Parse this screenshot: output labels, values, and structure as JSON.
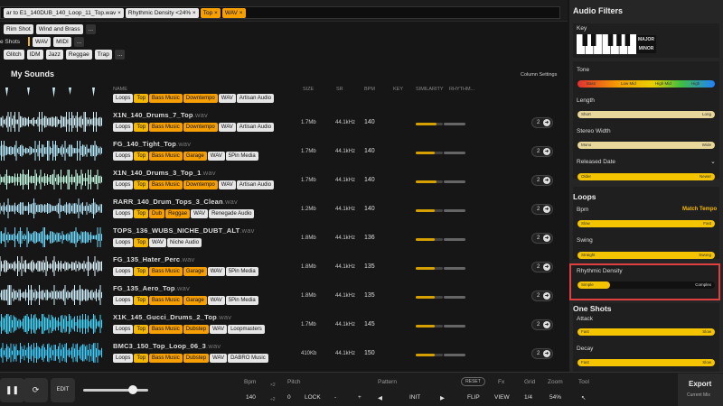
{
  "filter_bar": {
    "chips": [
      {
        "label": "ar to E1_140DUB_140_Loop_11_Top.wav",
        "style": "gray"
      },
      {
        "label": "Rhythmic Density <24%",
        "style": "gray"
      },
      {
        "label": "Top",
        "style": "org"
      },
      {
        "label": "WAV",
        "style": "org"
      }
    ],
    "close_glyph": "×"
  },
  "tag_rows": [
    [
      "Rim Shot",
      "Wind and Brass",
      "..."
    ],
    [
      "e Shots",
      "WAV",
      "MIDI",
      "..."
    ],
    [
      "Glitch",
      "IDM",
      "Jazz",
      "Reggae",
      "Trap",
      "..."
    ]
  ],
  "section_title": "My Sounds",
  "column_settings": "Column Settings",
  "headers": {
    "name": "NAME",
    "size": "SIZE",
    "sr": "SR",
    "bpm": "BPM",
    "key": "KEY",
    "similarity": "SIMILARITY",
    "rhythmic": "RHYTHM..."
  },
  "first_row_chips": [
    "Loops",
    "Top",
    "Bass Music",
    "Downtempo",
    "WAV",
    "Artisan Audio"
  ],
  "rows": [
    {
      "name": "X1N_140_Drums_7_Top",
      "ext": ".wav",
      "chips": [
        "Loops",
        "Top",
        "Bass Music",
        "Downtempo",
        "WAV",
        "Artisan Audio"
      ],
      "size": "1.7Mb",
      "sr": "44.1kHz",
      "bpm": "140",
      "sim": 0.75,
      "count": "2"
    },
    {
      "name": "FG_140_Tight_Top",
      "ext": ".wav",
      "chips": [
        "Loops",
        "Top",
        "Bass Music",
        "Garage",
        "WAV",
        "5Pin Media"
      ],
      "size": "1.7Mb",
      "sr": "44.1kHz",
      "bpm": "140",
      "sim": 0.7,
      "count": "2"
    },
    {
      "name": "X1N_140_Drums_3_Top_1",
      "ext": ".wav",
      "chips": [
        "Loops",
        "Top",
        "Bass Music",
        "Downtempo",
        "WAV",
        "Artisan Audio"
      ],
      "size": "1.7Mb",
      "sr": "44.1kHz",
      "bpm": "140",
      "sim": 0.75,
      "count": "2"
    },
    {
      "name": "RARR_140_Drum_Tops_3_Clean",
      "ext": ".wav",
      "chips": [
        "Loops",
        "Top",
        "Dub",
        "Reggae",
        "WAV",
        "Renegade Audio"
      ],
      "size": "1.2Mb",
      "sr": "44.1kHz",
      "bpm": "140",
      "sim": 0.7,
      "count": "2"
    },
    {
      "name": "TOPS_136_WUBS_NICHE_DUBT_ALT",
      "ext": ".wav",
      "chips": [
        "Loops",
        "Top",
        "WAV",
        "Niche Audio"
      ],
      "size": "1.8Mb",
      "sr": "44.1kHz",
      "bpm": "136",
      "sim": 0.7,
      "count": "2"
    },
    {
      "name": "FG_135_Hater_Perc",
      "ext": ".wav",
      "chips": [
        "Loops",
        "Top",
        "Bass Music",
        "Garage",
        "WAV",
        "5Pin Media"
      ],
      "size": "1.8Mb",
      "sr": "44.1kHz",
      "bpm": "135",
      "sim": 0.7,
      "count": "2"
    },
    {
      "name": "FG_135_Aero_Top",
      "ext": ".wav",
      "chips": [
        "Loops",
        "Top",
        "Bass Music",
        "Garage",
        "WAV",
        "5Pin Media"
      ],
      "size": "1.8Mb",
      "sr": "44.1kHz",
      "bpm": "135",
      "sim": 0.7,
      "count": "2"
    },
    {
      "name": "X1K_145_Gucci_Drums_2_Top",
      "ext": ".wav",
      "chips": [
        "Loops",
        "Top",
        "Bass Music",
        "Dubstep",
        "WAV",
        "Loopmasters"
      ],
      "size": "1.7Mb",
      "sr": "44.1kHz",
      "bpm": "145",
      "sim": 0.7,
      "count": "2"
    },
    {
      "name": "BMC3_150_Top_Loop_06_3",
      "ext": ".wav",
      "chips": [
        "Loops",
        "Top",
        "Bass Music",
        "Dubstep",
        "WAV",
        "DABRO Music"
      ],
      "size": "410Kb",
      "sr": "44.1kHz",
      "bpm": "150",
      "sim": 0.7,
      "count": "2"
    }
  ],
  "sidebar": {
    "title": "Audio Filters",
    "key_label": "Key",
    "major": "MAJOR",
    "minor": "MINOR",
    "tone_label": "Tone",
    "tone_bands": [
      "Bass",
      "Low Mid",
      "High Mid",
      "High"
    ],
    "length_label": "Length",
    "length_ends": [
      "Short",
      "Long"
    ],
    "stereo_label": "Stereo Width",
    "stereo_ends": [
      "Mono",
      "Wide"
    ],
    "released_label": "Released Date",
    "released_ends": [
      "Older",
      "Newer"
    ],
    "loops_title": "Loops",
    "bpm_label": "Bpm",
    "match_tempo": "Match Tempo",
    "bpm_ends": [
      "Slow",
      "Fast"
    ],
    "swing_label": "Swing",
    "swing_ends": [
      "Straight",
      "Swung"
    ],
    "density_label": "Rhythmic Density",
    "density_ends": [
      "Simple",
      "Complex"
    ],
    "density_value": 0.24,
    "oneshots_title": "One Shots",
    "attack_label": "Attack",
    "attack_ends": [
      "Fast",
      "Slow"
    ],
    "decay_label": "Decay",
    "decay_ends": [
      "Fast",
      "Slow"
    ]
  },
  "bottom": {
    "edit": "EDIT",
    "bpm_label": "Bpm",
    "bpm_value": "140",
    "x2": "×2",
    "half": "÷2",
    "pitch_label": "Pitch",
    "pitch_value": "0",
    "lock": "LOCK",
    "minus": "-",
    "plus": "+",
    "pattern_label": "Pattern",
    "init": "INIT",
    "reset": "RESET",
    "fx_label": "Fx",
    "flip": "FLIP",
    "grid_label": "Grid",
    "view": "VIEW",
    "grid_value": "1/4",
    "zoom_label": "Zoom",
    "zoom_value": "54%",
    "tool_label": "Tool",
    "export": "Export",
    "export_sub": "Current Mix"
  },
  "colors": {
    "accent": "#f5b800",
    "highlight_border": "#e04040"
  }
}
